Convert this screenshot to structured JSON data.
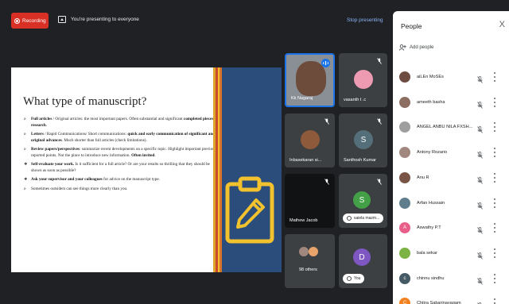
{
  "topbar": {
    "recording_label": "Recording",
    "presenting_text": "You're presenting to everyone",
    "stop_label": "Stop presenting"
  },
  "slide": {
    "title": "What type of manuscript?",
    "bullets": [
      {
        "mark": "o",
        "parts": [
          [
            "b",
            "Full articles"
          ],
          [
            "t",
            " / Original articles: the most important papers. Often substantial and significant "
          ],
          [
            "b",
            "completed pieces of research"
          ],
          [
            "t",
            "."
          ]
        ]
      },
      {
        "mark": "o",
        "parts": [
          [
            "b",
            "Letters"
          ],
          [
            "t",
            " / Rapid Communications/ Short communications: "
          ],
          [
            "b",
            "quick and early communication of significant and original advances"
          ],
          [
            "t",
            ". Much shorter than full articles (check limitations)."
          ]
        ]
      },
      {
        "mark": "o",
        "parts": [
          [
            "b",
            "Review papers/perspectives"
          ],
          [
            "t",
            ": summarize recent developments on a specific topic. Highlight important previously reported points. Not the place to introduce new information. "
          ],
          [
            "b",
            "Often invited"
          ],
          [
            "t",
            "."
          ]
        ]
      },
      {
        "mark": "❖",
        "parts": [
          [
            "b",
            "Self-evaluate your work."
          ],
          [
            "t",
            " Is it sufficient for a full article? Or are your results so thrilling that they should be shown as soon as possible?"
          ]
        ]
      },
      {
        "mark": "❖",
        "parts": [
          [
            "b",
            "Ask your supervisor and your colleagues"
          ],
          [
            "t",
            " for advice on the manuscript type."
          ]
        ]
      },
      {
        "mark": "o",
        "parts": [
          [
            "t",
            "Sometimes outsiders can see things more clearly than you."
          ]
        ]
      }
    ]
  },
  "tiles": {
    "nagaraj": "Kk Nagaraj",
    "vasanth": "vasanth t .c",
    "inbasekaran": "Inbasekaran si...",
    "santhosh": "Santhosh Kumar",
    "santhosh_initial": "S",
    "mathew": "Mathew Jacob",
    "saiela": "saiela mazm...",
    "saiela_initial": "S",
    "others": "98 others",
    "you_initial": "D",
    "you_label": "You"
  },
  "people": {
    "title": "People",
    "close": "X",
    "add_label": "Add people",
    "list": [
      {
        "name": "aiLEn MoSEs",
        "color": "#6d4c41",
        "initial": ""
      },
      {
        "name": "ameeth basha",
        "color": "#8d6e63",
        "initial": ""
      },
      {
        "name": "ANGEL ANBU NILA FXSH...",
        "color": "#9e9e9e",
        "initial": ""
      },
      {
        "name": "Antony Rozario",
        "color": "#a1887f",
        "initial": ""
      },
      {
        "name": "Anu R",
        "color": "#795548",
        "initial": ""
      },
      {
        "name": "Arfan Hussain",
        "color": "#607d8b",
        "initial": ""
      },
      {
        "name": "Aswathy P.T",
        "color": "#e8608a",
        "initial": "A"
      },
      {
        "name": "bala sekar",
        "color": "#7cb342",
        "initial": ""
      },
      {
        "name": "chinnu sindhu",
        "color": "#455a64",
        "initial": "c"
      },
      {
        "name": "Chitra Sabarinayagam",
        "color": "#f4811f",
        "initial": "C"
      }
    ]
  },
  "colors": {
    "record": "#d93025",
    "stop": "#8ab4f8",
    "slide_blue": "#2a4d7c",
    "clip_yellow": "#f2c12e",
    "speaking": "#1a73e8",
    "santhosh_avatar": "#546e7a",
    "saiela_avatar": "#43a047",
    "you_avatar": "#7e57c2"
  }
}
